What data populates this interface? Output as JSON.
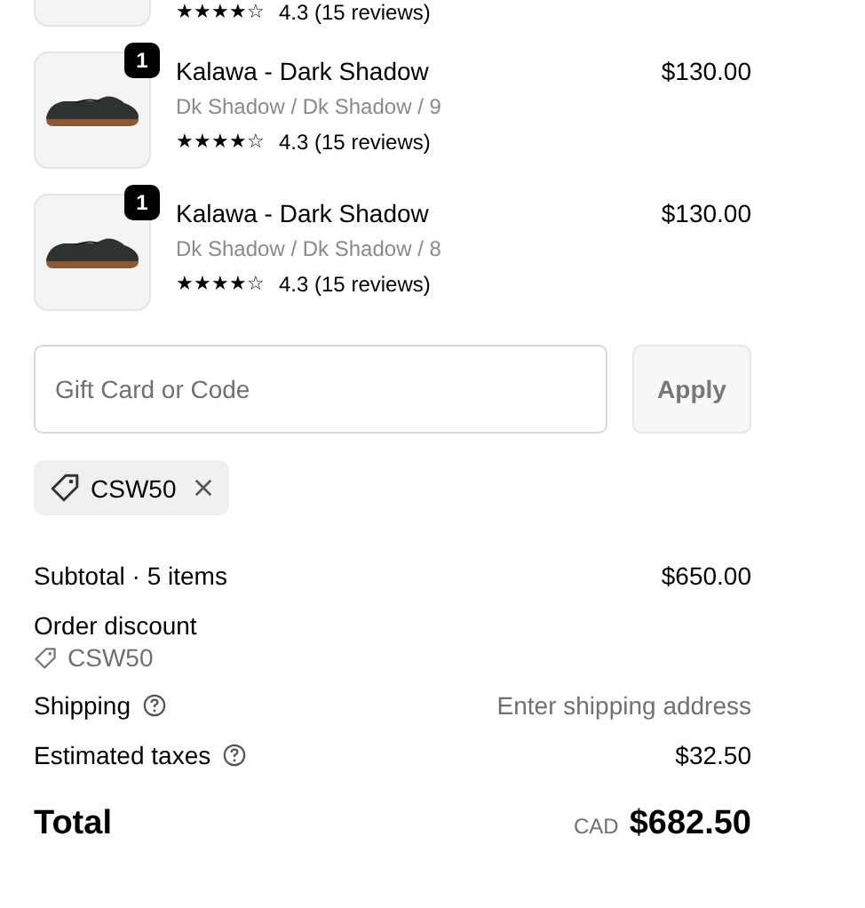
{
  "items": [
    {
      "kind": "partial",
      "stars": 4,
      "rating": "4.3 (15 reviews)"
    },
    {
      "kind": "full",
      "quantity": "1",
      "title": "Kalawa - Dark Shadow",
      "variant": "Dk Shadow / Dk Shadow / 9",
      "stars": 4,
      "rating": "4.3 (15 reviews)",
      "price": "$130.00"
    },
    {
      "kind": "full",
      "quantity": "1",
      "title": "Kalawa - Dark Shadow",
      "variant": "Dk Shadow / Dk Shadow / 8",
      "stars": 4,
      "rating": "4.3 (15 reviews)",
      "price": "$130.00"
    }
  ],
  "discount_field": {
    "placeholder": "Gift Card or Code"
  },
  "apply_button": {
    "label": "Apply",
    "disabled": true
  },
  "applied_codes": [
    {
      "code": "CSW50"
    }
  ],
  "summary": [
    {
      "kind": "line",
      "label": "Subtotal · 5 items",
      "value": "$650.00",
      "help": false,
      "muted": false
    },
    {
      "kind": "discount",
      "label": "Order discount",
      "code": "CSW50"
    },
    {
      "kind": "line",
      "label": "Shipping",
      "value": "Enter shipping address",
      "help": true,
      "muted": true
    },
    {
      "kind": "line",
      "label": "Estimated taxes",
      "value": "$32.50",
      "help": true,
      "muted": false
    }
  ],
  "total": {
    "label": "Total",
    "currency": "CAD",
    "amount": "$682.50"
  }
}
